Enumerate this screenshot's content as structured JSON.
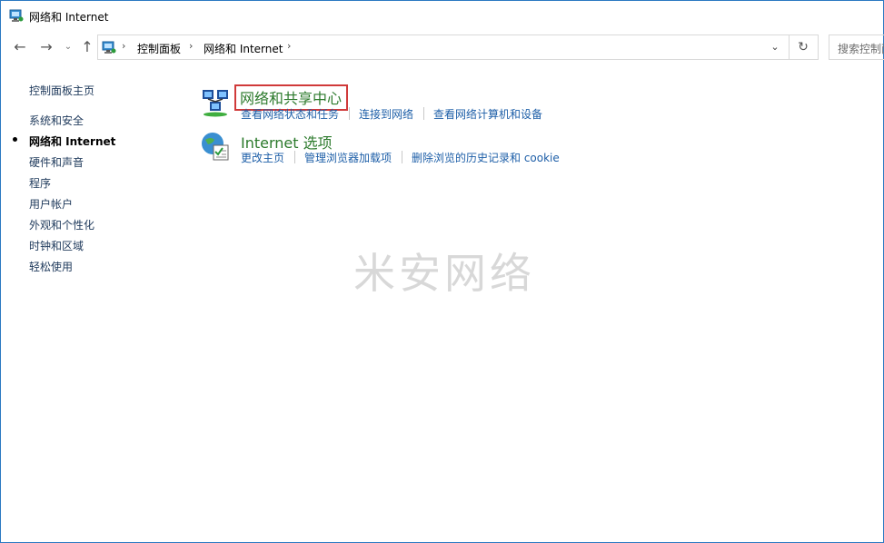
{
  "window": {
    "title": "网络和 Internet"
  },
  "address": {
    "crumbs": [
      "控制面板",
      "网络和 Internet"
    ],
    "search_placeholder": "搜索控制面板"
  },
  "sidebar": {
    "items": [
      {
        "label": "控制面板主页",
        "current": false
      },
      {
        "label": "系统和安全",
        "current": false
      },
      {
        "label": "网络和 Internet",
        "current": true
      },
      {
        "label": "硬件和声音",
        "current": false
      },
      {
        "label": "程序",
        "current": false
      },
      {
        "label": "用户帐户",
        "current": false
      },
      {
        "label": "外观和个性化",
        "current": false
      },
      {
        "label": "时钟和区域",
        "current": false
      },
      {
        "label": "轻松使用",
        "current": false
      }
    ]
  },
  "categories": [
    {
      "title": "网络和共享中心",
      "icon": "network-sharing-icon",
      "highlighted": true,
      "links": [
        "查看网络状态和任务",
        "连接到网络",
        "查看网络计算机和设备"
      ]
    },
    {
      "title": "Internet 选项",
      "icon": "internet-options-icon",
      "highlighted": false,
      "links": [
        "更改主页",
        "管理浏览器加载项",
        "删除浏览的历史记录和 cookie"
      ]
    }
  ],
  "watermark": "米安网络",
  "colors": {
    "category_title": "#2c7a2c",
    "link": "#1e5fa8",
    "highlight_box": "#d03a3a",
    "window_border": "#2b79c2"
  }
}
